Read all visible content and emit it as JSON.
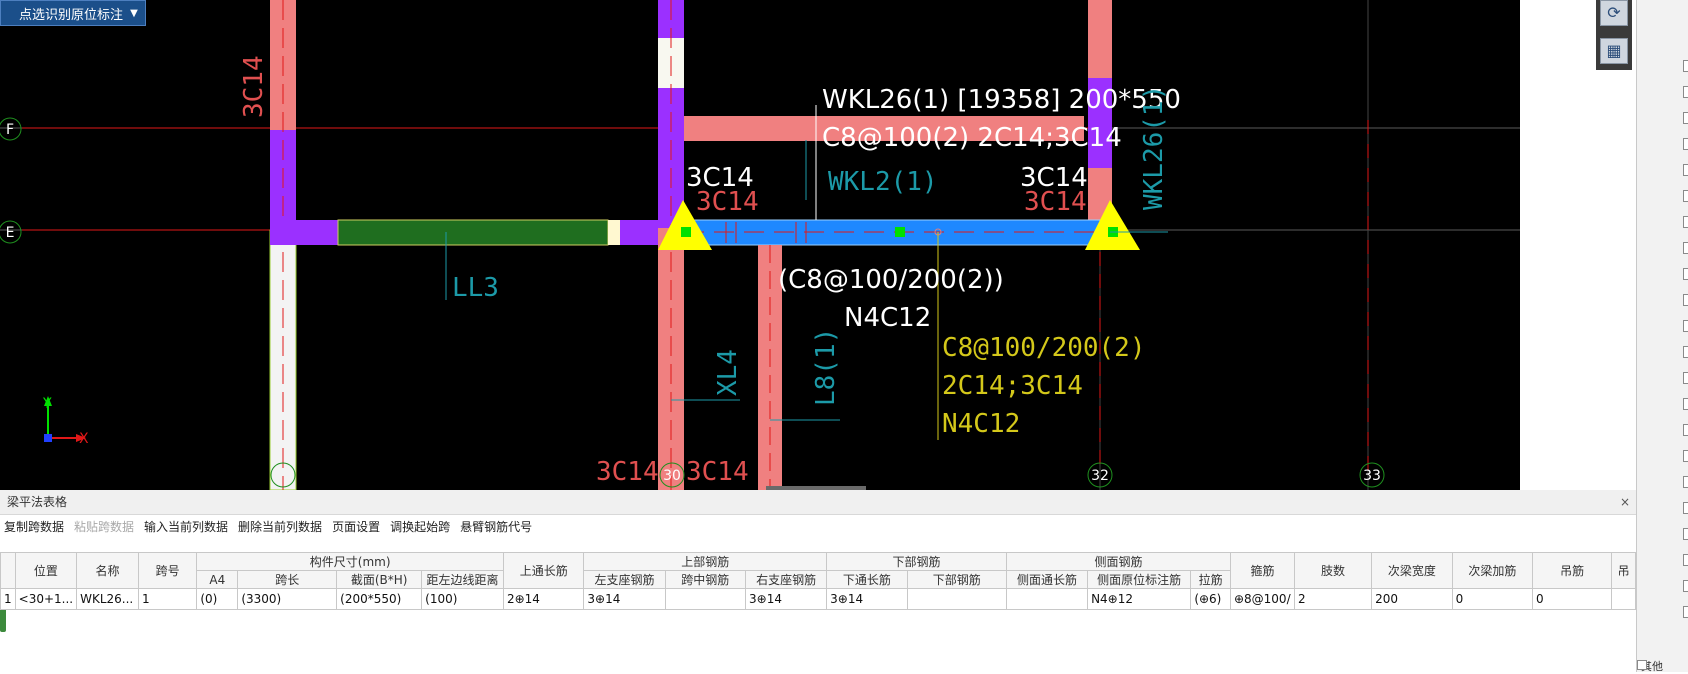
{
  "mode_dropdown": {
    "label": "点选识别原位标注",
    "icon": "chevron-down-icon"
  },
  "cad": {
    "beam_annotation": {
      "line1": "WKL26(1) [19358] 200*550",
      "line2": "C8@100(2) 2C14;3C14"
    },
    "labels": {
      "left_col_vertical": "3C14",
      "top_left_3c14": "3C14",
      "top_right_3c14": "3C14",
      "red_3c14_a": "3C14",
      "red_3c14_b": "3C14",
      "wkl2": "WKL2(1)",
      "wkl26_vertical": "WKL26(1)",
      "ll3": "LL3",
      "stirrup_white": "(C8@100/200(2))",
      "n4c12_white": "N4C12",
      "xl4": "XL4",
      "l8": "L8(1)",
      "yellow_line1": "C8@100/200(2)",
      "yellow_line2": "2C14;3C14",
      "yellow_line3": "N4C12",
      "bottom_3c14_a": "3C14",
      "bottom_3c14_b": "3C14"
    },
    "axes": {
      "F": "F",
      "E": "E",
      "n30": "30",
      "n32": "32",
      "n33": "33"
    },
    "ucs": {
      "x": "X",
      "y": "Y"
    }
  },
  "panel": {
    "title": "梁平法表格",
    "close": "×",
    "toolbar": [
      {
        "label": "复制跨数据",
        "enabled": true
      },
      {
        "label": "粘贴跨数据",
        "enabled": false
      },
      {
        "label": "输入当前列数据",
        "enabled": true
      },
      {
        "label": "删除当前列数据",
        "enabled": true
      },
      {
        "label": "页面设置",
        "enabled": true
      },
      {
        "label": "调换起始跨",
        "enabled": true
      },
      {
        "label": "悬臂钢筋代号",
        "enabled": true
      }
    ],
    "headers_top": {
      "position": "位置",
      "name": "名称",
      "span_no": "跨号",
      "dims_group": "构件尺寸(mm)",
      "top_through": "上通长筋",
      "top_group": "上部钢筋",
      "bottom_group": "下部钢筋",
      "side_group": "侧面钢筋",
      "stirrup": "箍筋",
      "legs": "肢数",
      "sec_width": "次梁宽度",
      "sec_add": "次梁加筋",
      "hanger": "吊筋",
      "hanger2": "吊"
    },
    "headers_sub": {
      "a4": "A4",
      "span_len": "跨长",
      "section": "截面(B*H)",
      "edge_dist": "距左边线距离",
      "left_support": "左支座钢筋",
      "mid_span": "跨中钢筋",
      "right_support": "右支座钢筋",
      "bottom_through": "下通长筋",
      "bottom_bars": "下部钢筋",
      "side_through": "侧面通长筋",
      "side_orig": "侧面原位标注筋",
      "tie": "拉筋"
    },
    "row": {
      "index": "1",
      "position": "<30+1...",
      "name": "WKL26...",
      "span_no": "1",
      "a4": "(0)",
      "span_len": "(3300)",
      "section": "(200*550)",
      "edge_dist": "(100)",
      "top_through": "2⊕14",
      "left_support": "3⊕14",
      "mid_span": "",
      "right_support": "3⊕14",
      "bottom_through": "3⊕14",
      "bottom_bars": "",
      "side_through": "",
      "side_orig": "N4⊕12",
      "tie": "(⊕6)",
      "stirrup": "⊕8@100/",
      "legs": "2",
      "sec_width": "200",
      "sec_add": "0",
      "hanger": "0",
      "hanger2": ""
    }
  },
  "right_panel": {
    "bottom_label": "其他"
  },
  "colors": {
    "background": "#000000",
    "beam_blue": "#1e88ff",
    "beam_pink": "#f08080",
    "column_purple": "#9b30ff",
    "green_beam": "#1f6e1f",
    "axis_red": "#e01818",
    "cyan_text": "#1c9aa8",
    "yellow_text": "#d4c81a",
    "support_yellow": "#ffff00",
    "node_green": "#00e000"
  }
}
